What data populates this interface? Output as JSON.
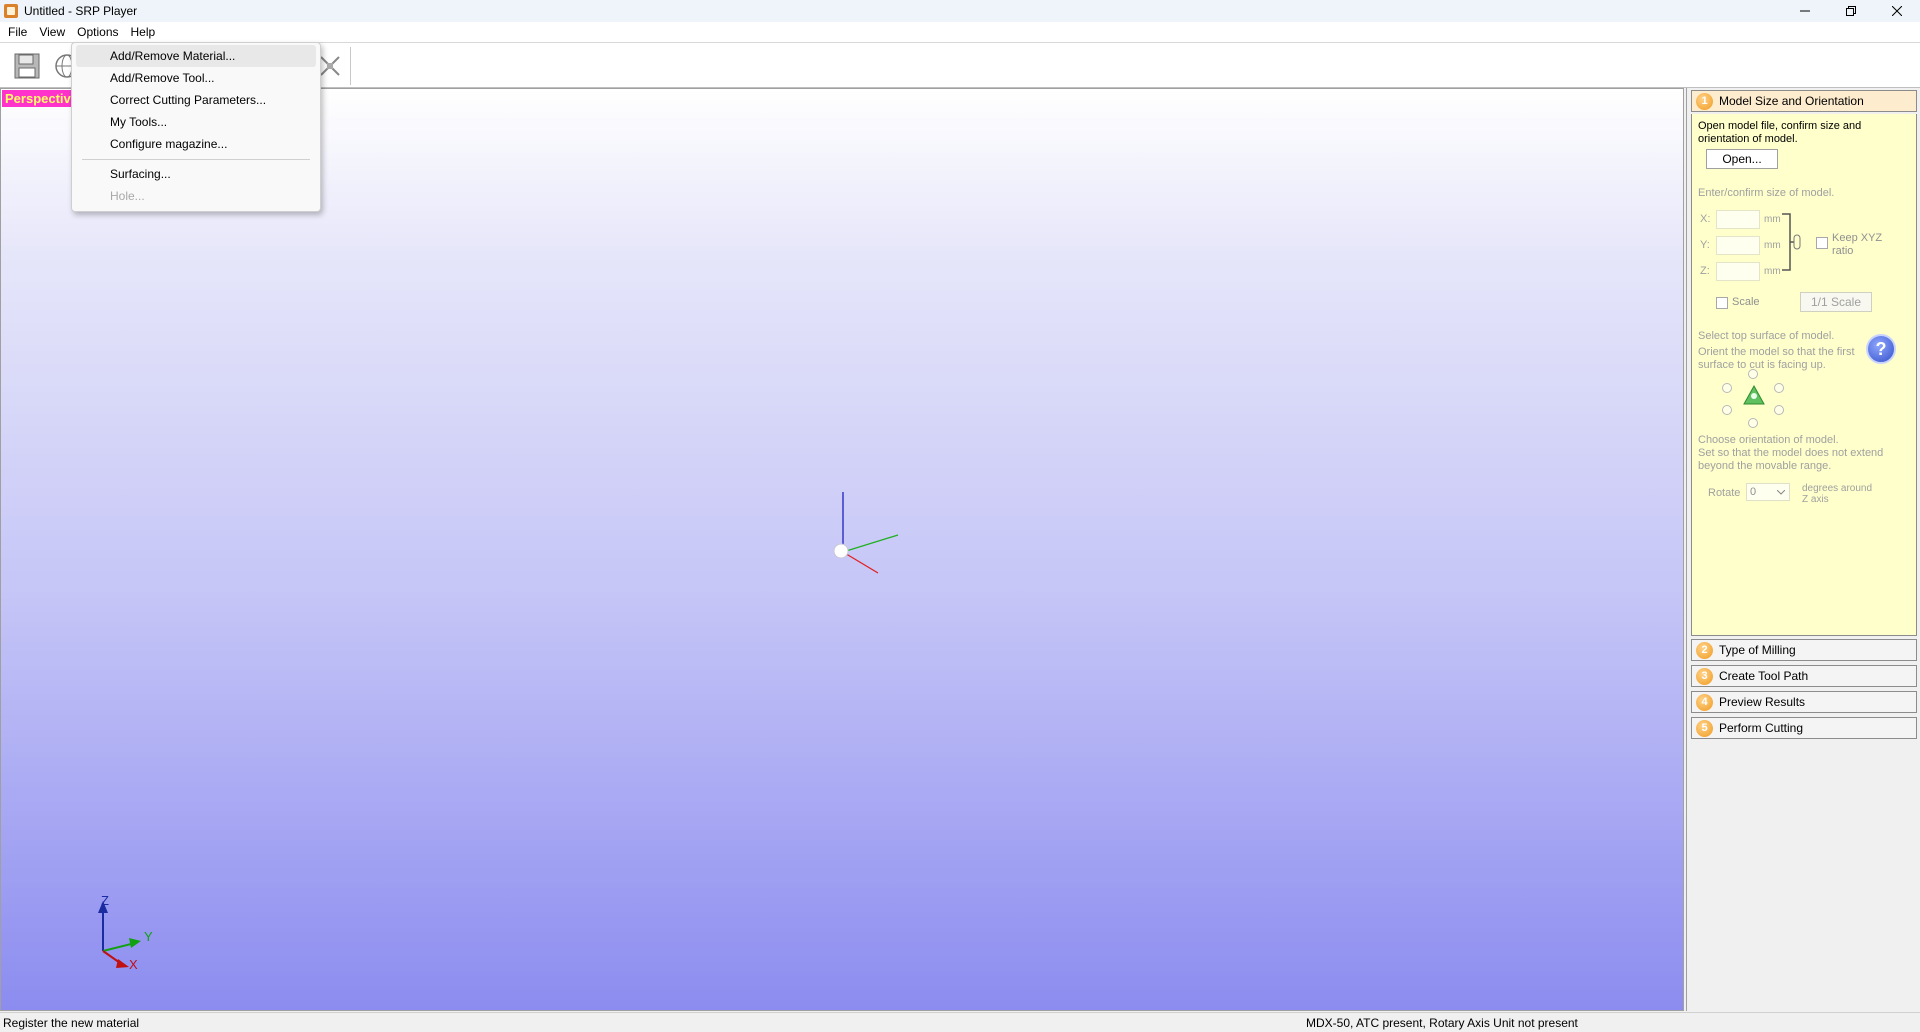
{
  "window": {
    "title": "Untitled - SRP Player",
    "controls": [
      "minimize",
      "restore",
      "close"
    ]
  },
  "menubar": {
    "items": [
      "File",
      "View",
      "Options",
      "Help"
    ]
  },
  "options_menu": {
    "items": [
      {
        "label": "Add/Remove Material...",
        "state": "highlighted"
      },
      {
        "label": "Add/Remove Tool...",
        "state": "enabled"
      },
      {
        "label": "Correct Cutting Parameters...",
        "state": "enabled"
      },
      {
        "label": "My Tools...",
        "state": "enabled"
      },
      {
        "label": "Configure magazine...",
        "state": "enabled"
      },
      {
        "label": "Surfacing...",
        "state": "enabled"
      },
      {
        "label": "Hole...",
        "state": "disabled"
      }
    ]
  },
  "toolbar": {
    "icons": [
      "save-icon",
      "globe-icon",
      "fit-view-icon"
    ]
  },
  "viewport": {
    "view_label": "Perspective",
    "axes": {
      "z": "Z",
      "y": "Y",
      "x": "X"
    }
  },
  "right_panel": {
    "steps": [
      {
        "number": "1",
        "label": "Model Size and Orientation",
        "active": true
      },
      {
        "number": "2",
        "label": "Type of Milling",
        "active": false
      },
      {
        "number": "3",
        "label": "Create Tool Path",
        "active": false
      },
      {
        "number": "4",
        "label": "Preview Results",
        "active": false
      },
      {
        "number": "5",
        "label": "Perform Cutting",
        "active": false
      }
    ],
    "step1": {
      "intro": "Open model file, confirm size and orientation of model.",
      "open_button": "Open...",
      "size_prompt": "Enter/confirm size of model.",
      "x_label": "X:",
      "y_label": "Y:",
      "z_label": "Z:",
      "unit": "mm",
      "x_value": "",
      "y_value": "",
      "z_value": "",
      "keep_ratio_label": "Keep XYZ ratio",
      "keep_ratio_checked": false,
      "scale_label": "Scale",
      "scale_checked": false,
      "one_to_one_button": "1/1 Scale",
      "top_surface_prompt": "Select top surface of model.",
      "orient_hint": "Orient the model so that the first surface to cut is facing up.",
      "orientation_prompt": "Choose orientation of model.",
      "range_hint": "Set so that the model does not extend beyond the movable range.",
      "rotate_label": "Rotate",
      "rotate_value": "0",
      "rotate_suffix": "degrees around Z axis"
    }
  },
  "statusbar": {
    "left": "Register the new material",
    "right": "MDX-50, ATC present, Rotary Axis Unit not present"
  },
  "colors": {
    "accent_orange": "#f09a1f",
    "step_bg": "#ffffcc",
    "perspective_bg": "#ff33cc",
    "perspective_text": "#ffff66"
  }
}
